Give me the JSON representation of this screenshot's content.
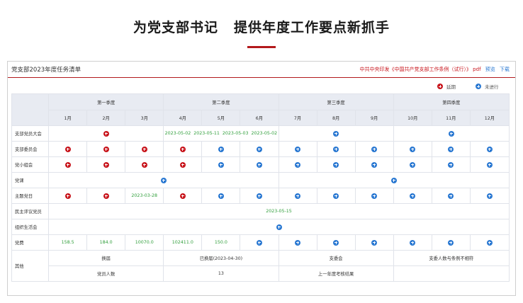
{
  "hero": {
    "title_part1": "为党支部书记",
    "title_part2": "提供年度工作要点新抓手"
  },
  "panel": {
    "title": "党支部2023年度任务清单",
    "source_text": "中共中央印发《中国共产党支部工作条例（试行）》 pdf",
    "preview_link": "预览",
    "download_link": "下载"
  },
  "legend": {
    "done_label": "延期",
    "todo_label": "未进行"
  },
  "quarters": [
    "第一季度",
    "第二季度",
    "第三季度",
    "第四季度"
  ],
  "months": [
    "1月",
    "2月",
    "3月",
    "4月",
    "5月",
    "6月",
    "7月",
    "8月",
    "9月",
    "10月",
    "11月",
    "12月"
  ],
  "rows": {
    "branch_congress": {
      "label": "支部党员大会",
      "q2_dates": [
        "2023-05-02",
        "2023-05-11",
        "2023-05-03",
        "2023-05-02"
      ]
    },
    "committee": {
      "label": "支部委员会"
    },
    "group_meeting": {
      "label": "党小组会"
    },
    "party_lecture": {
      "label": "党课"
    },
    "theme_day": {
      "label": "主题党日",
      "mar_date": "2023-03-28"
    },
    "evaluation": {
      "label": "民主评议党员",
      "date": "2023-05-15"
    },
    "org_life": {
      "label": "组织生活会"
    },
    "dues": {
      "label": "党费",
      "values": [
        "158.5",
        "184.0",
        "10070.0",
        "102411.0",
        "150.0"
      ]
    },
    "other": {
      "label": "其他",
      "election_label": "换届",
      "election_status": "已换届(2023-04-30)",
      "branch_label": "支委会",
      "branch_status": "支委人数与条例不相符",
      "members_label": "党员人数",
      "members_value": "13",
      "assessment_label": "上一年度考核结果",
      "assessment_value": ""
    }
  },
  "colors": {
    "accent": "#b3191c",
    "done": "#c8161d",
    "todo": "#2b79d2",
    "date_green": "#2f9e3a",
    "header_bg": "#e8ebf2"
  },
  "icons": {
    "done": "circle-plus-red-icon",
    "todo": "circle-plus-blue-icon"
  }
}
